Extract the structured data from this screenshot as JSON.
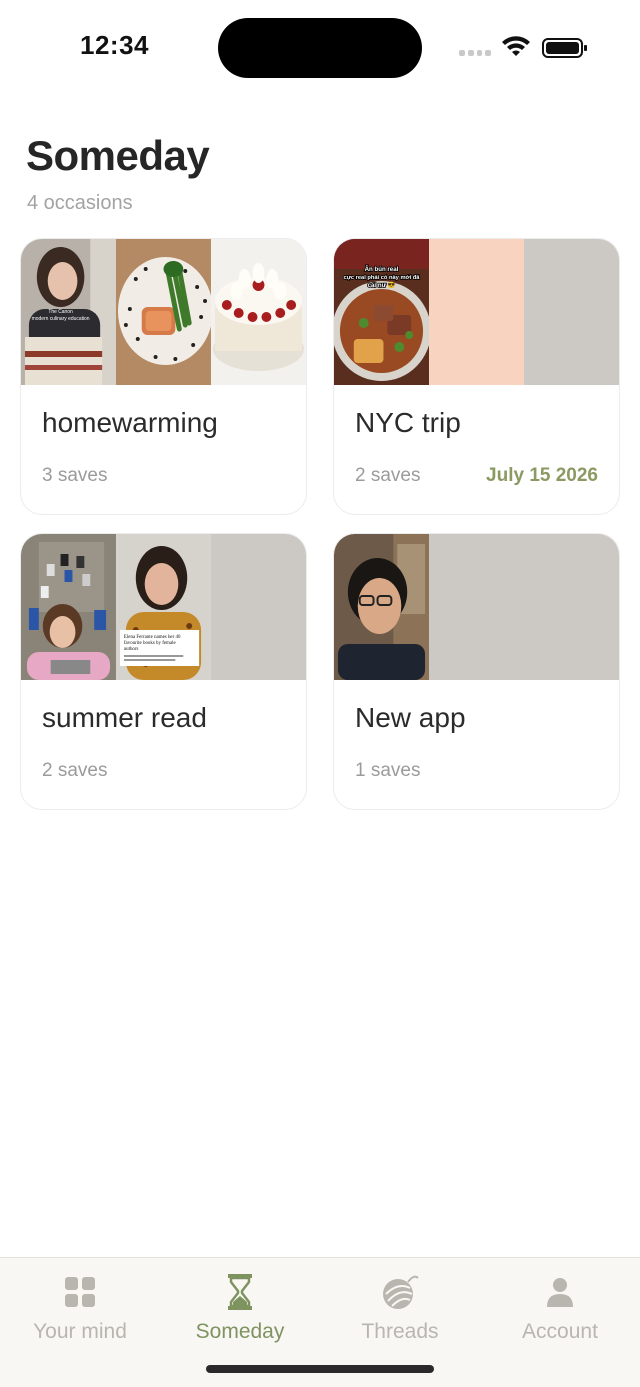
{
  "status": {
    "time": "12:34"
  },
  "header": {
    "title": "Someday",
    "subtitle": "4 occasions"
  },
  "occasions": [
    {
      "title": "homewarming",
      "saves": "3 saves",
      "date": ""
    },
    {
      "title": "NYC trip",
      "saves": "2 saves",
      "date": "July 15 2026"
    },
    {
      "title": "summer read",
      "saves": "2 saves",
      "date": ""
    },
    {
      "title": "New app",
      "saves": "1 saves",
      "date": ""
    }
  ],
  "thumb_text": {
    "canon_line1": "The Canon",
    "canon_line2": "modern culinary education",
    "bun_line1": "Ăn bún real",
    "bun_line2": "cực real phải có này mới đã",
    "bun_line3": "cái nư 😎",
    "ferrante_line1": "Elena Ferrante names her 40",
    "ferrante_line2": "favourite books by female",
    "ferrante_line3": "authors"
  },
  "tabs": [
    {
      "label": "Your mind",
      "icon": "grid-icon"
    },
    {
      "label": "Someday",
      "icon": "hourglass-icon",
      "active": true
    },
    {
      "label": "Threads",
      "icon": "threads-yarn-icon"
    },
    {
      "label": "Account",
      "icon": "person-icon"
    }
  ],
  "colors": {
    "accent": "#7f9360",
    "date": "#8a9a62",
    "inactive_tab": "#b9b6b0"
  }
}
